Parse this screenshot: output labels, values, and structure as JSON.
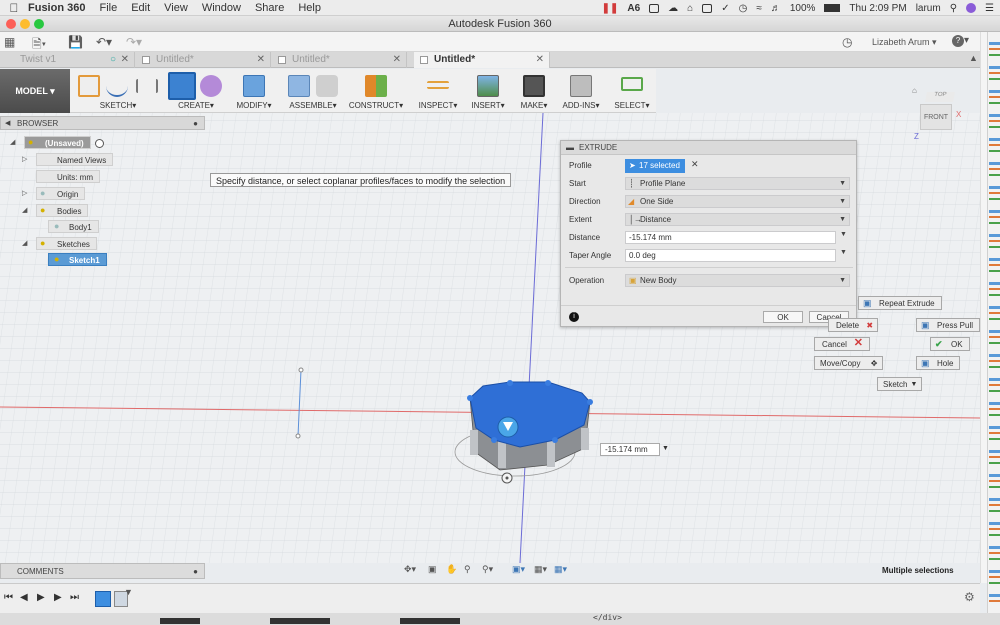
{
  "menubar": {
    "app_name": "Fusion 360",
    "menus": [
      "File",
      "Edit",
      "View",
      "Window",
      "Share",
      "Help"
    ],
    "badge_count": "6",
    "battery": "100%",
    "time": "Thu 2:09 PM",
    "user": "larum"
  },
  "window": {
    "title": "Autodesk Fusion 360"
  },
  "quickbar": {
    "user_name": "Lizabeth Arum",
    "help": "?"
  },
  "tabs": [
    {
      "label": "Twist v1"
    },
    {
      "label": "Untitled*"
    },
    {
      "label": "Untitled*"
    },
    {
      "label": "Untitled*"
    }
  ],
  "toolbar": {
    "model": "MODEL",
    "groups": [
      "SKETCH",
      "CREATE",
      "MODIFY",
      "ASSEMBLE",
      "CONSTRUCT",
      "INSPECT",
      "INSERT",
      "MAKE",
      "ADD-INS",
      "SELECT"
    ]
  },
  "browser": {
    "title": "BROWSER",
    "items": [
      {
        "label": "(Unsaved)"
      },
      {
        "label": "Named Views"
      },
      {
        "label": "Units: mm"
      },
      {
        "label": "Origin"
      },
      {
        "label": "Bodies"
      },
      {
        "label": "Body1"
      },
      {
        "label": "Sketches"
      },
      {
        "label": "Sketch1"
      }
    ]
  },
  "tooltip": "Specify distance, or select coplanar profiles/faces to modify the selection",
  "extrude": {
    "title": "EXTRUDE",
    "fields": {
      "profile": {
        "label": "Profile",
        "value": "17 selected"
      },
      "start": {
        "label": "Start",
        "value": "Profile Plane"
      },
      "direction": {
        "label": "Direction",
        "value": "One Side"
      },
      "extent": {
        "label": "Extent",
        "value": "Distance"
      },
      "distance": {
        "label": "Distance",
        "value": "-15.174 mm"
      },
      "taper": {
        "label": "Taper Angle",
        "value": "0.0 deg"
      },
      "operation": {
        "label": "Operation",
        "value": "New Body"
      }
    },
    "ok": "OK",
    "cancel": "Cancel"
  },
  "marking_menu": {
    "repeat": "Repeat Extrude",
    "delete": "Delete",
    "press_pull": "Press Pull",
    "cancel": "Cancel",
    "ok": "OK",
    "move_copy": "Move/Copy",
    "hole": "Hole",
    "sketch": "Sketch"
  },
  "viewport": {
    "distance_readout": "-15.174 mm",
    "viewcube_top": "TOP",
    "viewcube_front": "FRONT"
  },
  "comments": {
    "title": "COMMENTS"
  },
  "status": {
    "text": "Multiple selections"
  },
  "dock": {
    "snippet": "</div>"
  },
  "colors": {
    "accent": "#2c7fd9",
    "body_blue": "#2f6fd6",
    "selection": "#5b9bd5",
    "axis_red": "#e06a6a",
    "axis_blue": "#6b6bd6"
  }
}
